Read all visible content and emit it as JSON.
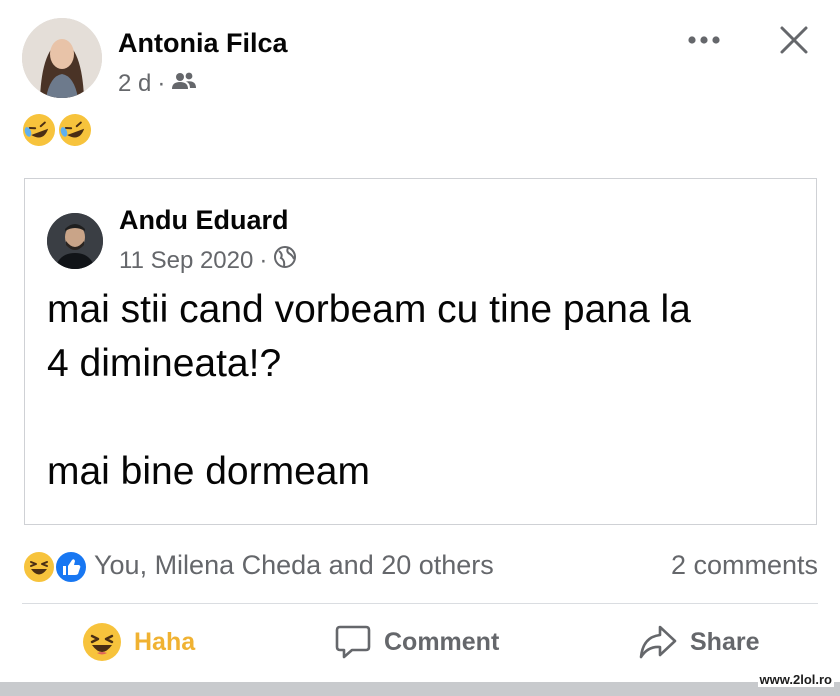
{
  "post": {
    "author": "Antonia Filca",
    "time": "2 d",
    "separator": "·",
    "audience_icon": "friends-icon",
    "text_emojis": [
      "rolling-on-floor-laughing-emoji",
      "rolling-on-floor-laughing-emoji"
    ]
  },
  "header_actions": {
    "more_icon": "more-icon",
    "close_icon": "close-icon"
  },
  "shared_post": {
    "author": "Andu Eduard",
    "date": "11 Sep 2020",
    "separator": "·",
    "audience_icon": "globe-icon",
    "lines": [
      "mai stii cand vorbeam cu tine pana la",
      "4 dimineata!?",
      "",
      "mai bine dormeam"
    ]
  },
  "reactions": {
    "icons": [
      "haha-reaction-icon",
      "like-reaction-icon"
    ],
    "summary": "You, Milena Cheda and 20 others",
    "comments": "2 comments"
  },
  "actions": {
    "haha": "Haha",
    "comment": "Comment",
    "share": "Share"
  },
  "colors": {
    "haha_accent": "#f0b232",
    "like_blue": "#1877f2",
    "secondary_text": "#65676b"
  },
  "watermark": "www.2lol.ro"
}
